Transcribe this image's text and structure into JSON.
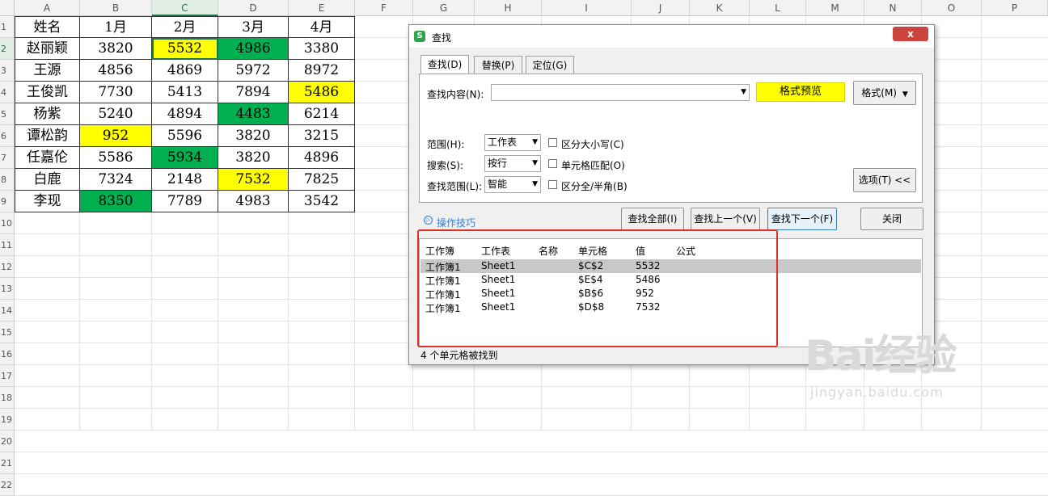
{
  "sheet": {
    "columns": [
      "A",
      "B",
      "C",
      "D",
      "E",
      "F",
      "G",
      "H",
      "I",
      "J",
      "K",
      "L",
      "M",
      "N",
      "O",
      "P"
    ],
    "rows": [
      "1",
      "2",
      "3",
      "4",
      "5",
      "6",
      "7",
      "8",
      "9",
      "10",
      "11",
      "12",
      "13",
      "14",
      "15",
      "16",
      "17",
      "18",
      "19",
      "20",
      "21",
      "22"
    ],
    "header": [
      "姓名",
      "1月",
      "2月",
      "3月",
      "4月"
    ],
    "data": [
      [
        "赵丽颖",
        "3820",
        "5532",
        "4986",
        "3380"
      ],
      [
        "王源",
        "4856",
        "4869",
        "5972",
        "8972"
      ],
      [
        "王俊凯",
        "7730",
        "5413",
        "7894",
        "5486"
      ],
      [
        "杨紫",
        "5240",
        "4894",
        "4483",
        "6214"
      ],
      [
        "谭松韵",
        "952",
        "5596",
        "3820",
        "3215"
      ],
      [
        "任嘉伦",
        "5586",
        "5934",
        "3820",
        "4896"
      ],
      [
        "白鹿",
        "7324",
        "2148",
        "7532",
        "7825"
      ],
      [
        "李现",
        "8350",
        "7789",
        "4983",
        "3542"
      ]
    ],
    "fills": {
      "1-2": "#ffff00",
      "1-3": "#00b050",
      "3-4": "#ffff00",
      "4-3": "#00b050",
      "5-1": "#ffff00",
      "6-2": "#00b050",
      "7-3": "#ffff00",
      "8-1": "#00b050"
    }
  },
  "dialog": {
    "title": "查找",
    "app_icon": "S",
    "close_label": "x",
    "tabs": [
      "查找(D)",
      "替换(P)",
      "定位(G)"
    ],
    "find_label": "查找内容(N):",
    "find_value": "",
    "format_preview": "格式预览",
    "format_button": "格式(M)",
    "scope_label": "范围(H):",
    "scope_value": "工作表",
    "search_label": "搜索(S):",
    "search_value": "按行",
    "lookin_label": "查找范围(L):",
    "lookin_value": "智能",
    "opt_case": "区分大小写(C)",
    "opt_cell": "单元格匹配(O)",
    "opt_width": "区分全/半角(B)",
    "options_button": "选项(T) <<",
    "tips": "操作技巧",
    "btn_find_all": "查找全部(I)",
    "btn_find_prev": "查找上一个(V)",
    "btn_find_next": "查找下一个(F)",
    "btn_close": "关闭",
    "result_headers": [
      "工作簿",
      "工作表",
      "名称",
      "单元格",
      "值",
      "公式"
    ],
    "results": [
      [
        "工作簿1",
        "Sheet1",
        "",
        "$C$2",
        "5532",
        ""
      ],
      [
        "工作簿1",
        "Sheet1",
        "",
        "$E$4",
        "5486",
        ""
      ],
      [
        "工作簿1",
        "Sheet1",
        "",
        "$B$6",
        "952",
        ""
      ],
      [
        "工作簿1",
        "Sheet1",
        "",
        "$D$8",
        "7532",
        ""
      ]
    ],
    "status": "4 个单元格被找到"
  },
  "watermark": {
    "brand": "Bai经验",
    "url": "jingyan.baidu.com"
  }
}
